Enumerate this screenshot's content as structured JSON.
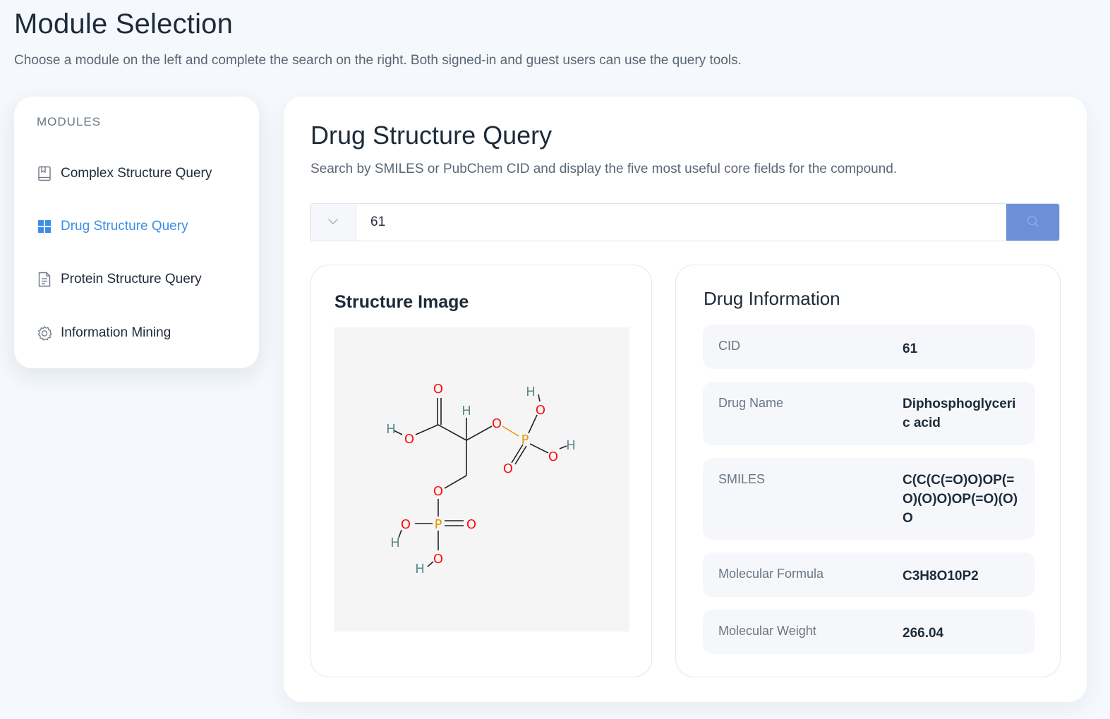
{
  "header": {
    "title": "Module Selection",
    "subtitle": "Choose a module on the left and complete the search on the right. Both signed-in and guest users can use the query tools."
  },
  "sidebar": {
    "heading": "MODULES",
    "items": [
      {
        "label": "Complex Structure Query",
        "icon": "book-icon",
        "active": false
      },
      {
        "label": "Drug Structure Query",
        "icon": "grid-icon",
        "active": true
      },
      {
        "label": "Protein Structure Query",
        "icon": "document-icon",
        "active": false
      },
      {
        "label": "Information Mining",
        "icon": "gear-icon",
        "active": false
      }
    ]
  },
  "main": {
    "title": "Drug Structure Query",
    "subtitle": "Search by SMILES or PubChem CID and display the five most useful core fields for the compound.",
    "search": {
      "value": "61",
      "select_icon": "chevron-down-icon",
      "button_icon": "search-icon"
    },
    "structure": {
      "heading": "Structure Image",
      "atom_labels": [
        "O",
        "H",
        "H",
        "O",
        "O",
        "H",
        "O",
        "P",
        "O",
        "H",
        "O",
        "O",
        "O",
        "P",
        "O",
        "H",
        "O",
        "H"
      ]
    },
    "info": {
      "heading": "Drug Information",
      "rows": [
        {
          "label": "CID",
          "value": "61"
        },
        {
          "label": "Drug Name",
          "value": "Diphosphoglyceric acid"
        },
        {
          "label": "SMILES",
          "value": "C(C(C(=O)O)OP(=O)(O)O)OP(=O)(O)O"
        },
        {
          "label": "Molecular Formula",
          "value": "C3H8O10P2"
        },
        {
          "label": "Molecular Weight",
          "value": "266.04"
        }
      ]
    }
  },
  "colors": {
    "accent": "#3b8ee8",
    "search_button": "#6d8fd9",
    "oxygen": "#ff0d0d",
    "phosphorus": "#e69500",
    "hydrogen": "#5b8a8a",
    "bond": "#222222"
  }
}
